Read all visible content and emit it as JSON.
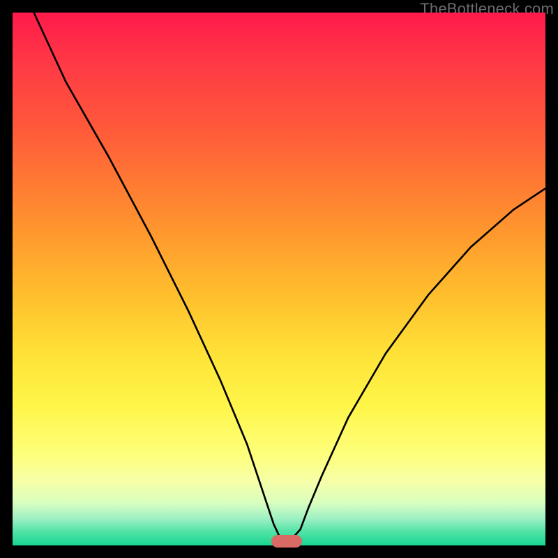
{
  "watermark": "TheBottleneck.com",
  "chart_data": {
    "type": "line",
    "title": "",
    "xlabel": "",
    "ylabel": "",
    "xlim": [
      0,
      100
    ],
    "ylim": [
      0,
      100
    ],
    "grid": false,
    "legend": false,
    "series": [
      {
        "name": "bottleneck-curve",
        "x": [
          4,
          10,
          18,
          26,
          33,
          39,
          44,
          47,
          49,
          50.5,
          52,
          54,
          55.5,
          58,
          63,
          70,
          78,
          86,
          94,
          100
        ],
        "values": [
          100,
          87,
          73,
          58,
          44,
          31,
          19,
          10,
          4,
          0.8,
          0.8,
          3,
          7,
          13,
          24,
          36,
          47,
          56,
          63,
          67
        ]
      }
    ],
    "annotations": [
      {
        "name": "min-marker",
        "x": 51.5,
        "y": 0.8,
        "shape": "rounded-pill",
        "color": "#d96b64"
      }
    ],
    "background_gradient": {
      "direction": "top-to-bottom",
      "stops": [
        {
          "pos": 0,
          "color": "#ff1a4b"
        },
        {
          "pos": 50,
          "color": "#ffbf2d"
        },
        {
          "pos": 80,
          "color": "#fdff7c"
        },
        {
          "pos": 100,
          "color": "#17d690"
        }
      ]
    }
  },
  "marker_style": {
    "left_pct": 51.5,
    "bottom_pct": 0.8
  }
}
